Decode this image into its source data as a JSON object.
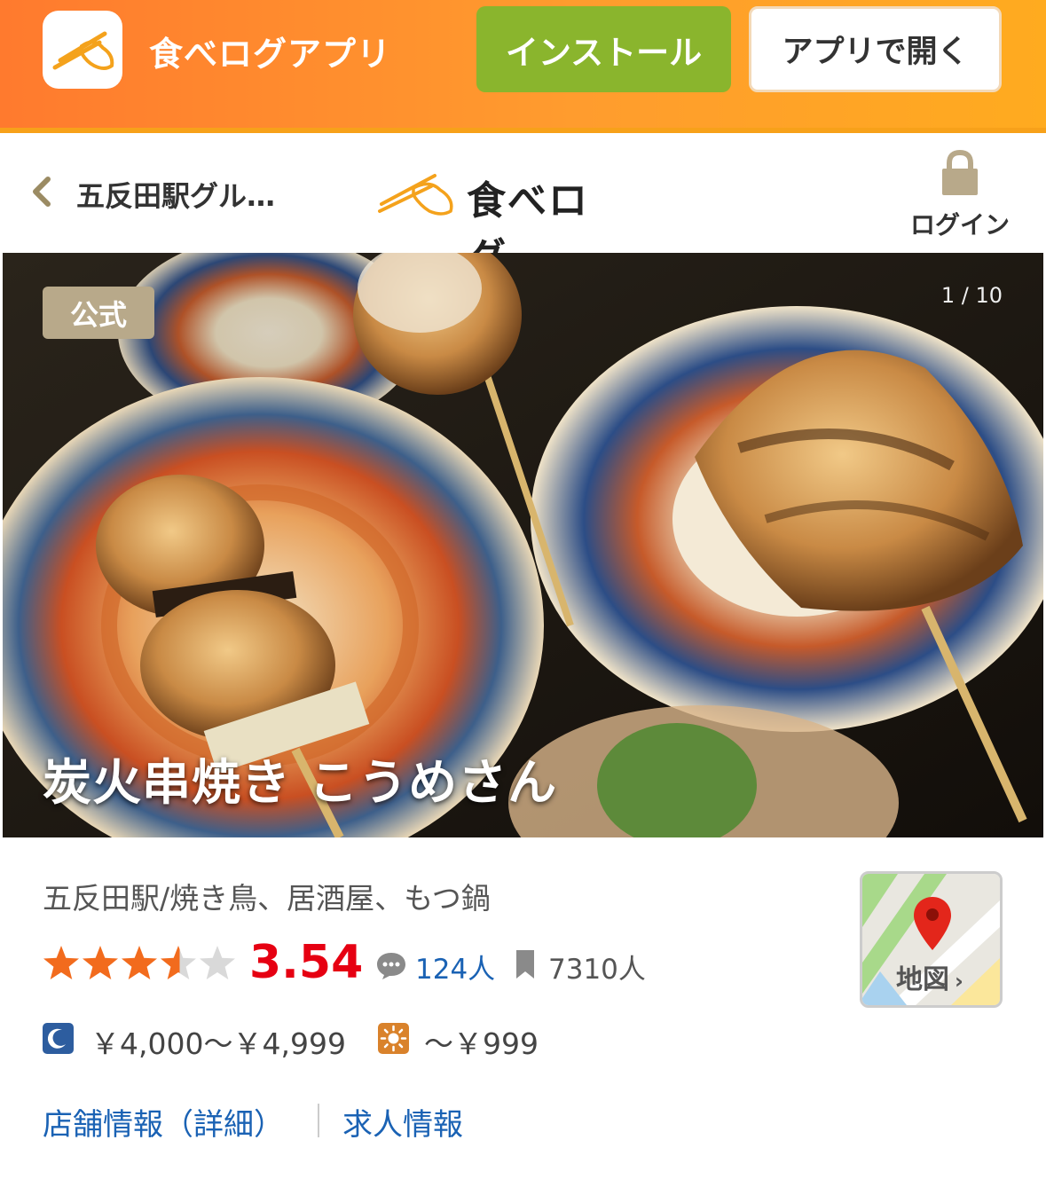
{
  "app_banner": {
    "app_name": "食べログアプリ",
    "install_label": "インストール",
    "open_label": "アプリで開く"
  },
  "header": {
    "breadcrumb": "五反田駅グル…",
    "logo_text": "食べログ",
    "login_label": "ログイン"
  },
  "hero": {
    "badge": "公式",
    "counter": "1 / 10",
    "shop_name": "炭火串焼き こうめさん"
  },
  "info": {
    "genre": "五反田駅/焼き鳥、居酒屋、もつ鍋",
    "rating": {
      "stars_value": 3.54,
      "score": "3.54",
      "review_count": "124人",
      "bookmark_count": "7310人",
      "score_color": "#e60012",
      "star_color": "#f26b1d"
    },
    "price": {
      "dinner": "￥4,000～￥4,999",
      "lunch": "～￥999"
    },
    "map_label": "地図"
  },
  "links": {
    "detail": "店舗情報（詳細）",
    "jobs": "求人情報"
  },
  "colors": {
    "banner_gradient_start": "#ff7a2e",
    "banner_gradient_end": "#ffab1f",
    "install_button": "#8ab52d",
    "link": "#1a62b4"
  }
}
